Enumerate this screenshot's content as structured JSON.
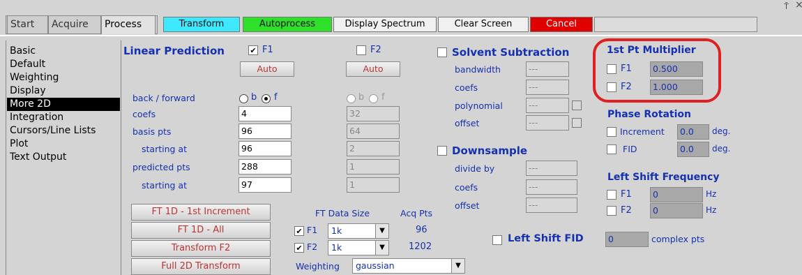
{
  "tabs": [
    "Start",
    "Acquire",
    "Process"
  ],
  "toolbar": {
    "transform": "Transform",
    "autoprocess": "Autoprocess",
    "display_spectrum": "Display Spectrum",
    "clear_screen": "Clear Screen",
    "cancel": "Cancel",
    "colors": {
      "transform": "#3ee8ff",
      "autoprocess": "#2ee02a",
      "cancel": "#e00000"
    }
  },
  "window_controls": {
    "pin": "⍑",
    "close": "×"
  },
  "sidebar": [
    "Basic",
    "Default",
    "Weighting",
    "Display",
    "More 2D",
    "Integration",
    "Cursors/Line Lists",
    "Plot",
    "Text Output"
  ],
  "sidebar_selected": "More 2D",
  "lp": {
    "title": "Linear Prediction",
    "f1_label": "F1",
    "f2_label": "F2",
    "f1_checked": true,
    "f2_checked": false,
    "auto": "Auto",
    "back_forward": "back / forward",
    "radio_b": "b",
    "radio_f": "f",
    "coefs": "coefs",
    "basis_pts": "basis pts",
    "starting_at": "starting at",
    "predicted_pts": "predicted pts",
    "f1_values": [
      "4",
      "96",
      "96",
      "288",
      "97"
    ],
    "f2_values": [
      "32",
      "64",
      "2",
      "1",
      "1"
    ]
  },
  "solvent": {
    "title": "Solvent Subtraction",
    "bandwidth": "bandwidth",
    "coefs": "coefs",
    "polynomial": "polynomial",
    "offset": "offset",
    "value": "---"
  },
  "downsample": {
    "title": "Downsample",
    "divide_by": "divide by",
    "coefs": "coefs",
    "offset": "offset",
    "value": "---"
  },
  "first_pt": {
    "title": "1st Pt Multiplier",
    "f1": "F1",
    "f2": "F2",
    "f1_value": "0.500",
    "f2_value": "1.000"
  },
  "phase": {
    "title": "Phase Rotation",
    "increment": "Increment",
    "fid": "FID",
    "increment_value": "0.0",
    "fid_value": "0.0",
    "unit": "deg."
  },
  "lsf": {
    "title": "Left Shift Frequency",
    "f1": "F1",
    "f2": "F2",
    "f1_value": "0",
    "f2_value": "0",
    "unit": "Hz"
  },
  "left_shift_fid": {
    "label": "Left Shift FID",
    "value": "0",
    "unit": "complex pts"
  },
  "actions": [
    "FT 1D - 1st Increment",
    "FT 1D - All",
    "Transform F2",
    "Full 2D Transform"
  ],
  "ft": {
    "data_size": "FT Data Size",
    "acq_pts": "Acq Pts",
    "f1": "F1",
    "f2": "F2",
    "f1_size": "1k",
    "f2_size": "1k",
    "f1_acq": "96",
    "f2_acq": "1202",
    "weighting": "Weighting",
    "weighting_value": "gaussian"
  }
}
